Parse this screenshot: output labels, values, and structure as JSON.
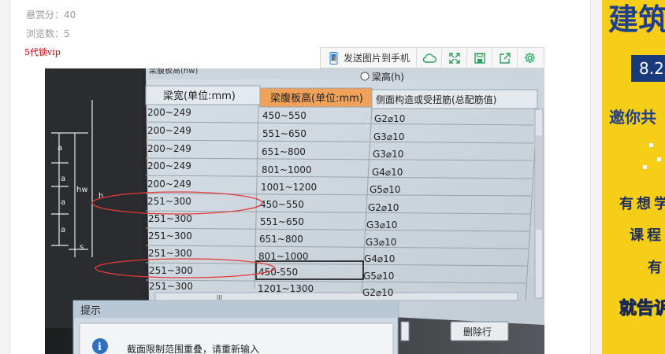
{
  "meta": {
    "reward": "悬赏分：40",
    "views": "浏览数：5"
  },
  "vip_text": "5代锁vip",
  "toolbar": {
    "send_label": "发送图片到手机"
  },
  "photo": {
    "radio_label": "梁高(h)",
    "top_cut_label": "梁腹板高(hw)",
    "headers": [
      "梁宽(单位:mm)",
      "梁腹板高(单位:mm)",
      "侧面构造或受扭筋(总配筋值)"
    ],
    "rows": [
      [
        "200~249",
        "450~550",
        "G2⌀10"
      ],
      [
        "200~249",
        "551~650",
        "G3⌀10"
      ],
      [
        "200~249",
        "651~800",
        "G3⌀10"
      ],
      [
        "200~249",
        "801~1000",
        "G4⌀10"
      ],
      [
        "200~249",
        "1001~1200",
        "G5⌀10"
      ],
      [
        "251~300",
        "450~550",
        "G2⌀10"
      ],
      [
        "251~300",
        "551~650",
        "G3⌀10"
      ],
      [
        "251~300",
        "651~800",
        "G3⌀10"
      ],
      [
        "251~300",
        "801~1000",
        "G4⌀10"
      ],
      [
        "251~300",
        "450-550",
        "G5⌀10"
      ],
      [
        "251~300",
        "1201~1300",
        "G2⌀10"
      ]
    ],
    "diagram_labels": {
      "a1": "a",
      "a2": "a",
      "a3": "a",
      "a4": "a",
      "hw": "hw",
      "h": "h",
      "s": "s"
    },
    "dialog_title": "提示",
    "dialog_message": "截面限制范围重叠，请重新输入",
    "delete_row_label": "删除行",
    "scroll_mark": "III"
  },
  "sidebar": {
    "title": "建筑",
    "date": "8.2",
    "invite": "邀你共",
    "line1": "有想学",
    "line2": "课程",
    "line3": "有",
    "bottom": "就告诉"
  },
  "colors": {
    "accent_red": "#cc0000",
    "sidebar_yellow": "#f7ce17",
    "sidebar_blue": "#1f3f8f"
  }
}
